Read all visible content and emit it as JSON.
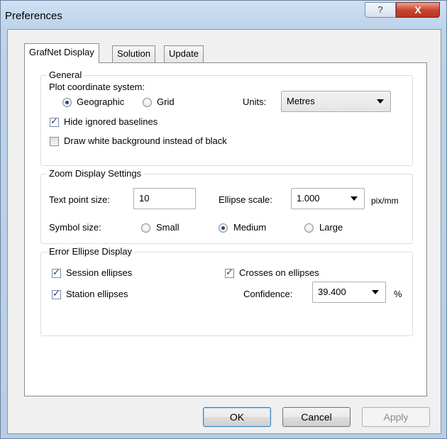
{
  "window": {
    "title": "Preferences",
    "help_glyph": "?",
    "close_glyph": "X"
  },
  "tabs": [
    {
      "label": "GrafNet Display",
      "active": true
    },
    {
      "label": "Solution",
      "active": false
    },
    {
      "label": "Update",
      "active": false
    }
  ],
  "general": {
    "legend": "General",
    "plot_label": "Plot coordinate system:",
    "geographic_label": "Geographic",
    "geographic_selected": true,
    "grid_label": "Grid",
    "grid_selected": false,
    "units_label": "Units:",
    "units_value": "Metres",
    "hide_baselines_label": "Hide ignored baselines",
    "hide_baselines_checked": true,
    "white_bg_label": "Draw white background instead of black",
    "white_bg_checked": false
  },
  "zoom": {
    "legend": "Zoom Display Settings",
    "text_point_label": "Text point size:",
    "text_point_value": "10",
    "ellipse_scale_label": "Ellipse scale:",
    "ellipse_scale_value": "1.000",
    "ellipse_scale_unit": "pix/mm",
    "symbol_size_label": "Symbol size:",
    "small_label": "Small",
    "medium_label": "Medium",
    "large_label": "Large",
    "selected_size": "Medium"
  },
  "error_ellipse": {
    "legend": "Error Ellipse Display",
    "session_label": "Session ellipses",
    "session_checked": true,
    "station_label": "Station ellipses",
    "station_checked": true,
    "crosses_label": "Crosses on ellipses",
    "crosses_checked": true,
    "confidence_label": "Confidence:",
    "confidence_value": "39.400",
    "confidence_unit": "%"
  },
  "buttons": {
    "ok": "OK",
    "cancel": "Cancel",
    "apply": "Apply"
  },
  "colors": {
    "title_bg": "#bcd3ea",
    "close_red": "#c9462f",
    "dialog_bg": "#f0f0f0",
    "panel_bg": "#ffffff"
  }
}
